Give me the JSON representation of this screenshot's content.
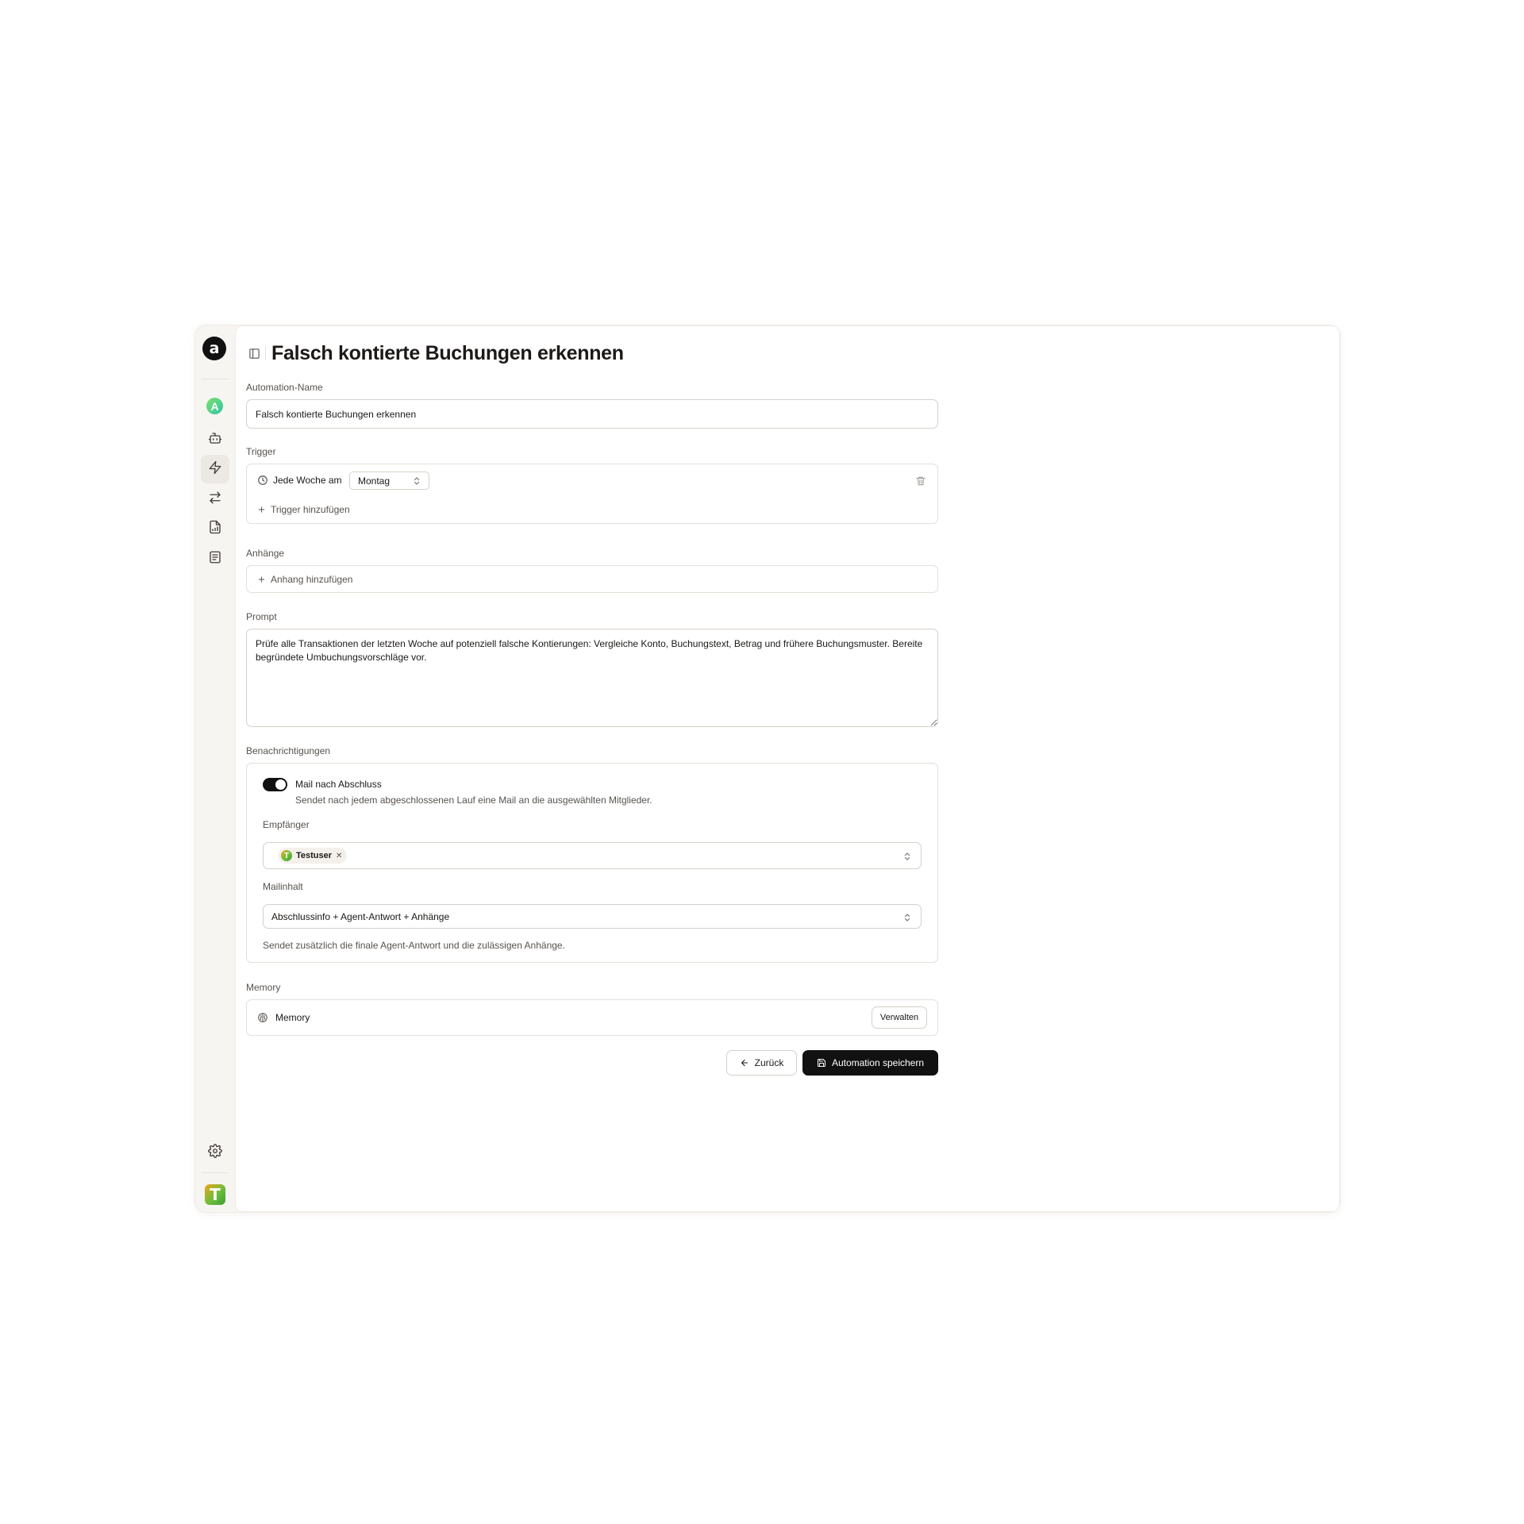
{
  "page": {
    "title": "Falsch kontierte Buchungen erkennen"
  },
  "rail": {
    "logo_letter": "a",
    "workspace_letter": "A",
    "user_initial": "T",
    "items": [
      {
        "name": "agents",
        "icon": "bot-icon"
      },
      {
        "name": "automations",
        "icon": "zap-icon",
        "active": true
      },
      {
        "name": "transactions",
        "icon": "arrows-left-right-icon"
      },
      {
        "name": "reports",
        "icon": "file-chart-icon"
      },
      {
        "name": "documents",
        "icon": "list-document-icon"
      }
    ],
    "settings_icon": "gear-icon"
  },
  "form": {
    "name_label": "Automation-Name",
    "name_value": "Falsch kontierte Buchungen erkennen",
    "trigger": {
      "label": "Trigger",
      "rule_text": "Jede Woche am",
      "day_value": "Montag",
      "add_label": "Trigger hinzufügen"
    },
    "attachments": {
      "label": "Anhänge",
      "add_label": "Anhang hinzufügen"
    },
    "prompt": {
      "label": "Prompt",
      "value": "Prüfe alle Transaktionen der letzten Woche auf potenziell falsche Kontierungen: Vergleiche Konto, Buchungstext, Betrag und frühere Buchungsmuster. Bereite begründete Umbuchungsvorschläge vor."
    },
    "notifications": {
      "label": "Benachrichtigungen",
      "mail_toggle_label": "Mail nach Abschluss",
      "mail_toggle_on": true,
      "mail_toggle_description": "Sendet nach jedem abgeschlossenen Lauf eine Mail an die ausgewählten Mitglieder.",
      "recipients_label": "Empfänger",
      "recipients": [
        {
          "name": "Testuser",
          "initial": "T"
        }
      ],
      "content_label": "Mailinhalt",
      "content_value": "Abschlussinfo + Agent-Antwort + Anhänge",
      "content_hint": "Sendet zusätzlich die finale Agent-Antwort und die zulässigen Anhänge."
    },
    "memory": {
      "label": "Memory",
      "row_label": "Memory",
      "manage_label": "Verwalten"
    }
  },
  "actions": {
    "back_label": "Zurück",
    "save_label": "Automation speichern"
  },
  "colors": {
    "primary": "#111111",
    "background": "#f7f5f2",
    "border": "#e4dfd9"
  }
}
